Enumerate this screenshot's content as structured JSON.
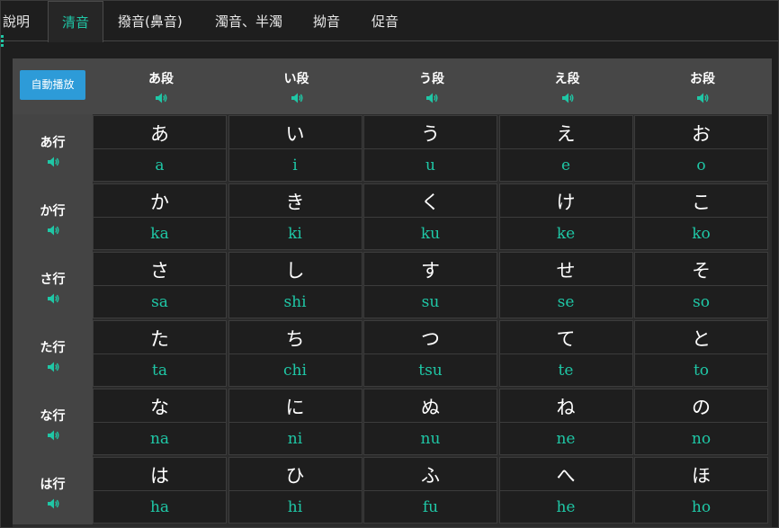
{
  "tabs": [
    {
      "label": "說明",
      "active": false
    },
    {
      "label": "清音",
      "active": true
    },
    {
      "label": "撥音(鼻音)",
      "active": false
    },
    {
      "label": "濁音、半濁",
      "active": false
    },
    {
      "label": "拗音",
      "active": false
    },
    {
      "label": "促音",
      "active": false
    }
  ],
  "autoplay_label": "自動播放",
  "columns": [
    "あ段",
    "い段",
    "う段",
    "え段",
    "お段"
  ],
  "rows": [
    {
      "label": "あ行",
      "cells": [
        {
          "kana": "あ",
          "romaji": "a"
        },
        {
          "kana": "い",
          "romaji": "i"
        },
        {
          "kana": "う",
          "romaji": "u"
        },
        {
          "kana": "え",
          "romaji": "e"
        },
        {
          "kana": "お",
          "romaji": "o"
        }
      ]
    },
    {
      "label": "か行",
      "cells": [
        {
          "kana": "か",
          "romaji": "ka"
        },
        {
          "kana": "き",
          "romaji": "ki"
        },
        {
          "kana": "く",
          "romaji": "ku"
        },
        {
          "kana": "け",
          "romaji": "ke"
        },
        {
          "kana": "こ",
          "romaji": "ko"
        }
      ]
    },
    {
      "label": "さ行",
      "cells": [
        {
          "kana": "さ",
          "romaji": "sa"
        },
        {
          "kana": "し",
          "romaji": "shi"
        },
        {
          "kana": "す",
          "romaji": "su"
        },
        {
          "kana": "せ",
          "romaji": "se"
        },
        {
          "kana": "そ",
          "romaji": "so"
        }
      ]
    },
    {
      "label": "た行",
      "cells": [
        {
          "kana": "た",
          "romaji": "ta"
        },
        {
          "kana": "ち",
          "romaji": "chi"
        },
        {
          "kana": "つ",
          "romaji": "tsu"
        },
        {
          "kana": "て",
          "romaji": "te"
        },
        {
          "kana": "と",
          "romaji": "to"
        }
      ]
    },
    {
      "label": "な行",
      "cells": [
        {
          "kana": "な",
          "romaji": "na"
        },
        {
          "kana": "に",
          "romaji": "ni"
        },
        {
          "kana": "ぬ",
          "romaji": "nu"
        },
        {
          "kana": "ね",
          "romaji": "ne"
        },
        {
          "kana": "の",
          "romaji": "no"
        }
      ]
    },
    {
      "label": "は行",
      "cells": [
        {
          "kana": "は",
          "romaji": "ha"
        },
        {
          "kana": "ひ",
          "romaji": "hi"
        },
        {
          "kana": "ふ",
          "romaji": "fu"
        },
        {
          "kana": "へ",
          "romaji": "he"
        },
        {
          "kana": "ほ",
          "romaji": "ho"
        }
      ]
    }
  ],
  "colors": {
    "accent": "#1fc7a6",
    "button": "#2d9bd8",
    "header_bg": "#474747"
  },
  "icons": {
    "speaker": "speaker-icon"
  }
}
